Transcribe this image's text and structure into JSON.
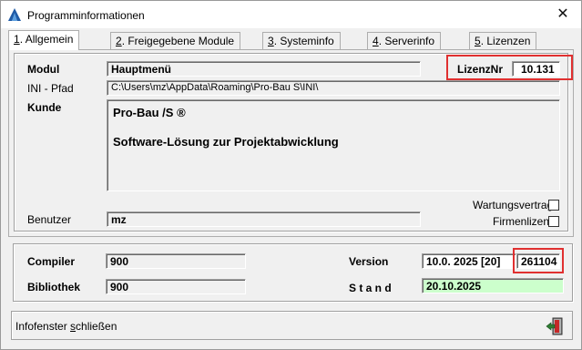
{
  "window": {
    "title": "Programminformationen",
    "close_symbol": "✕"
  },
  "tabs": [
    {
      "key": "1",
      "label": ". Allgemein",
      "active": true
    },
    {
      "key": "2",
      "label": ". Freigegebene Module",
      "active": false
    },
    {
      "key": "3",
      "label": ". Systeminfo",
      "active": false
    },
    {
      "key": "4",
      "label": ". Serverinfo",
      "active": false
    },
    {
      "key": "5",
      "label": ". Lizenzen",
      "active": false
    }
  ],
  "general": {
    "modul_label": "Modul",
    "modul_value": "Hauptmenü",
    "lizenz_label": "LizenzNr",
    "lizenz_value": "10.131",
    "ini_label": "INI - Pfad",
    "ini_value": "C:\\Users\\mz\\AppData\\Roaming\\Pro-Bau S\\INI\\",
    "kunde_label": "Kunde",
    "kunde_line1": "Pro-Bau /S ®",
    "kunde_line2": "Software-Lösung zur Projektabwicklung",
    "wartung_label": "Wartungsvertrag",
    "firmen_label": "Firmenlizenz",
    "benutzer_label": "Benutzer",
    "benutzer_value": "mz"
  },
  "build": {
    "compiler_label": "Compiler",
    "compiler_value": "900",
    "bibliothek_label": "Bibliothek",
    "bibliothek_value": "900",
    "version_label": "Version",
    "version_value": "10.0. 2025 [20]",
    "build_value": "261104",
    "stand_label": "S t a n d",
    "stand_value": "20.10.2025"
  },
  "footer": {
    "close_prefix": "Infofenster ",
    "close_underlined": "s",
    "close_suffix": "chließen"
  },
  "colors": {
    "highlight_red": "#e03030",
    "date_green": "#ccffcc"
  }
}
